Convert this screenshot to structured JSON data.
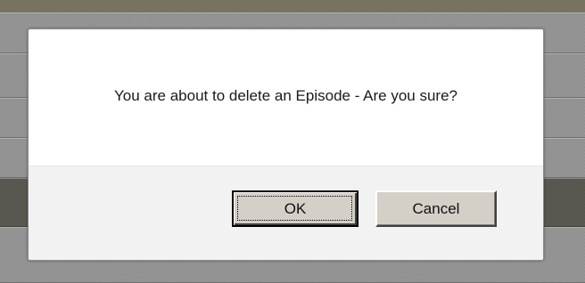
{
  "dialog": {
    "message": "You are about to delete an Episode - Are you sure?",
    "ok_label": "OK",
    "cancel_label": "Cancel"
  }
}
